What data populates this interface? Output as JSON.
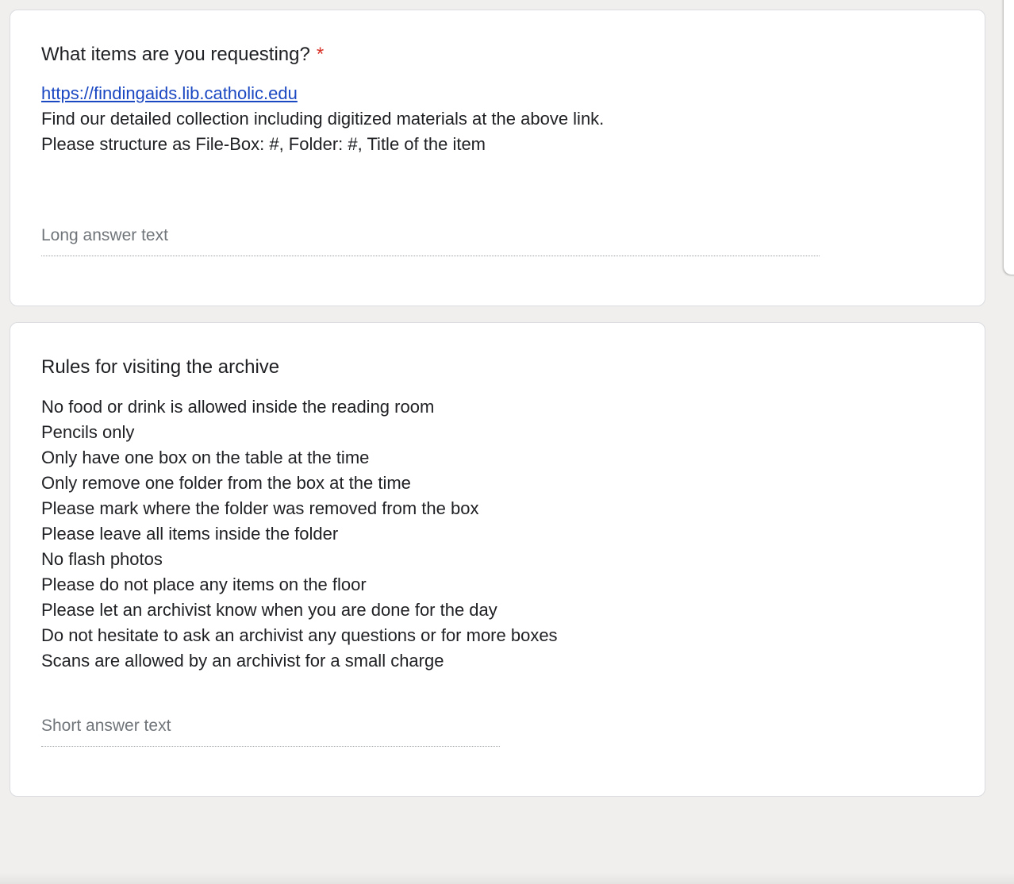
{
  "question1": {
    "title": "What items are you requesting?",
    "required_mark": "*",
    "link": "https://findingaids.lib.catholic.edu",
    "lines": [
      "Find our detailed collection including digitized materials at the above link.",
      "Please structure as File-Box: #, Folder: #, Title of the item"
    ],
    "placeholder": "Long answer text"
  },
  "question2": {
    "title": "Rules for visiting the archive",
    "rules": [
      "No food or drink is allowed inside the reading room",
      "Pencils only",
      "Only have one box on the table at the time",
      "Only remove one folder from the box at the time",
      "Please mark where the folder was removed from the box",
      "Please leave all items inside the folder",
      "No flash photos",
      "Please do not place any items on the floor",
      "Please let an archivist know when you are done for the day",
      "Do not hesitate to ask an archivist any questions or for more boxes",
      "Scans are allowed by an archivist for a small charge"
    ],
    "placeholder": "Short answer text"
  }
}
